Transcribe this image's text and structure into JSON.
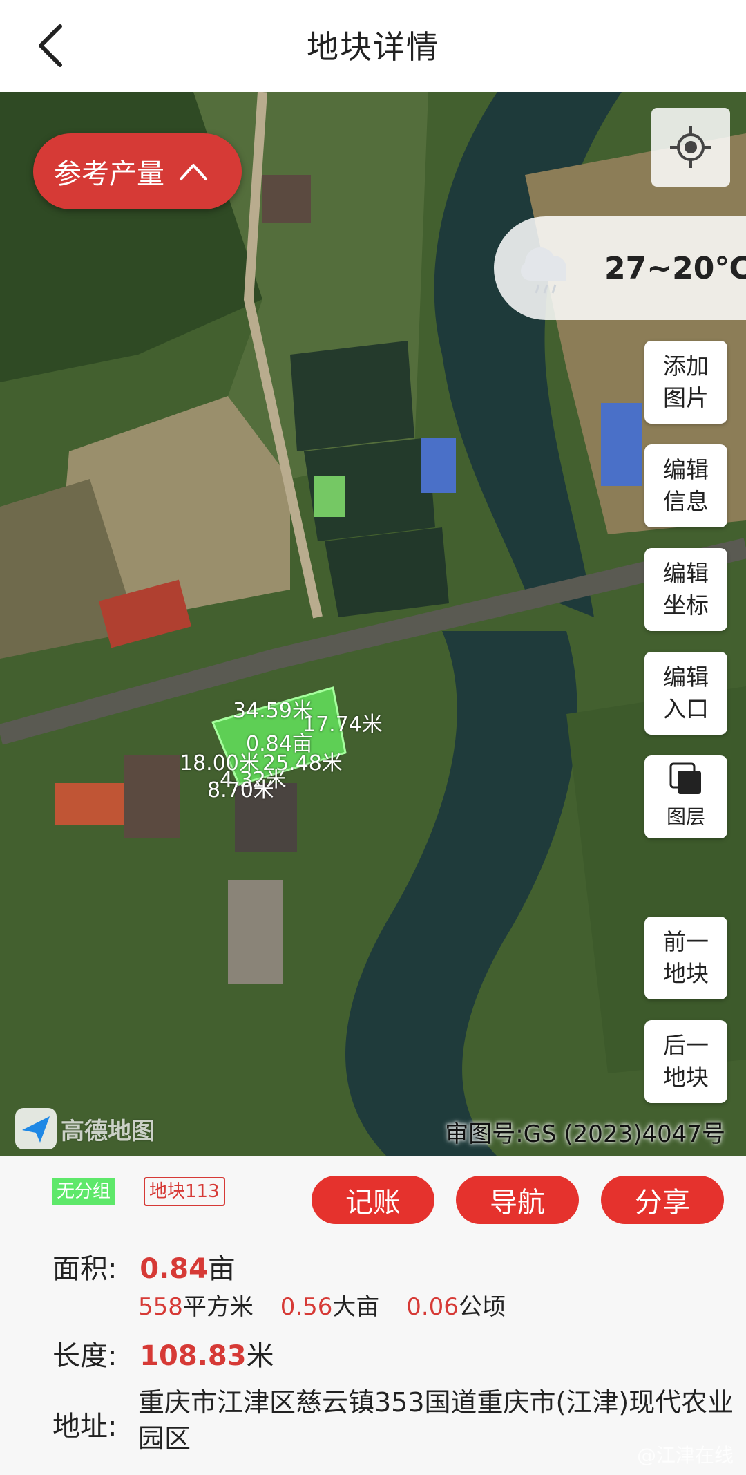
{
  "header": {
    "title": "地块详情",
    "back_icon": "chevron-left-icon"
  },
  "map": {
    "reference_yield_label": "参考产量",
    "weather": {
      "temperature": "27~20℃",
      "icon": "cloud-rain-icon"
    },
    "side_buttons": {
      "add_image": [
        "添加",
        "图片"
      ],
      "edit_info": [
        "编辑",
        "信息"
      ],
      "edit_coords": [
        "编辑",
        "坐标"
      ],
      "edit_entrance": [
        "编辑",
        "入口"
      ],
      "layers": "图层",
      "prev_plot": [
        "前一",
        "地块"
      ],
      "next_plot": [
        "后一",
        "地块"
      ]
    },
    "plot_labels": {
      "edge_top": "34.59米",
      "edge_right": "17.74米",
      "area": "0.84亩",
      "edge_left": "18.00米",
      "edge_bottom": "25.48米",
      "edge_small1": "4.32米",
      "edge_small2": "8.70米"
    },
    "logo_text": "高德地图",
    "approval_number": "审图号:GS (2023)4047号"
  },
  "info": {
    "group_tag": "无分组",
    "plot_tag": "地块113",
    "actions": {
      "bookkeeping": "记账",
      "navigate": "导航",
      "share": "分享"
    },
    "area": {
      "label": "面积:",
      "value": "0.84",
      "unit": "亩",
      "sqm_value": "558",
      "sqm_unit": "平方米",
      "big_mu_value": "0.56",
      "big_mu_unit": "大亩",
      "hectare_value": "0.06",
      "hectare_unit": "公顷"
    },
    "length": {
      "label": "长度:",
      "value": "108.83",
      "unit": "米"
    },
    "address": {
      "label": "地址:",
      "value": "重庆市江津区慈云镇353国道重庆市(江津)现代农业园区"
    },
    "watermark": "@江津在线"
  },
  "colors": {
    "accent": "#e5322d",
    "plot_green": "#5ee86a"
  }
}
